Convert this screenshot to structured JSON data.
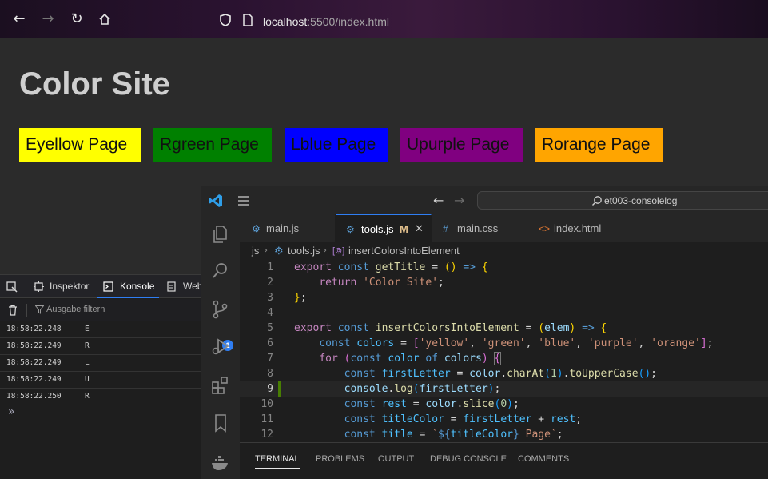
{
  "browser": {
    "url_host": "localhost",
    "url_rest": ":5500/index.html"
  },
  "page": {
    "title": "Color Site",
    "buttons": [
      {
        "label": "Eyellow Page",
        "color": "#ffff00"
      },
      {
        "label": "Rgreen Page",
        "color": "#008000"
      },
      {
        "label": "Lblue Page",
        "color": "#0000ff"
      },
      {
        "label": "Upurple Page",
        "color": "#800080"
      },
      {
        "label": "Rorange Page",
        "color": "#ffa500"
      }
    ]
  },
  "devtools": {
    "tabs": [
      "Inspektor",
      "Konsole",
      "Web"
    ],
    "active_tab": "Konsole",
    "filter_placeholder": "Ausgabe filtern",
    "logs": [
      {
        "time": "18:58:22.248",
        "msg": "E"
      },
      {
        "time": "18:58:22.249",
        "msg": "R"
      },
      {
        "time": "18:58:22.249",
        "msg": "L"
      },
      {
        "time": "18:58:22.249",
        "msg": "U"
      },
      {
        "time": "18:58:22.250",
        "msg": "R"
      }
    ],
    "prompt": "»"
  },
  "vscode": {
    "search_text": "et003-consolelog",
    "tabs": [
      {
        "label": "main.js",
        "icon": "gear-icon"
      },
      {
        "label": "tools.js",
        "icon": "gear-icon",
        "modified": "M",
        "active": true
      },
      {
        "label": "main.css",
        "icon": "hash-icon"
      },
      {
        "label": "index.html",
        "icon": "html-tag-icon"
      }
    ],
    "breadcrumb": [
      "js",
      "tools.js",
      "insertColorsIntoElement"
    ],
    "current_line": 9,
    "line_numbers": [
      "1",
      "2",
      "3",
      "4",
      "5",
      "6",
      "7",
      "8",
      "9",
      "10",
      "11",
      "12"
    ],
    "panel_tabs": [
      "TERMINAL",
      "PROBLEMS",
      "OUTPUT",
      "DEBUG CONSOLE",
      "COMMENTS"
    ],
    "panel_active": "TERMINAL",
    "scm_badge": "1",
    "accent": "#2f7ef3"
  }
}
